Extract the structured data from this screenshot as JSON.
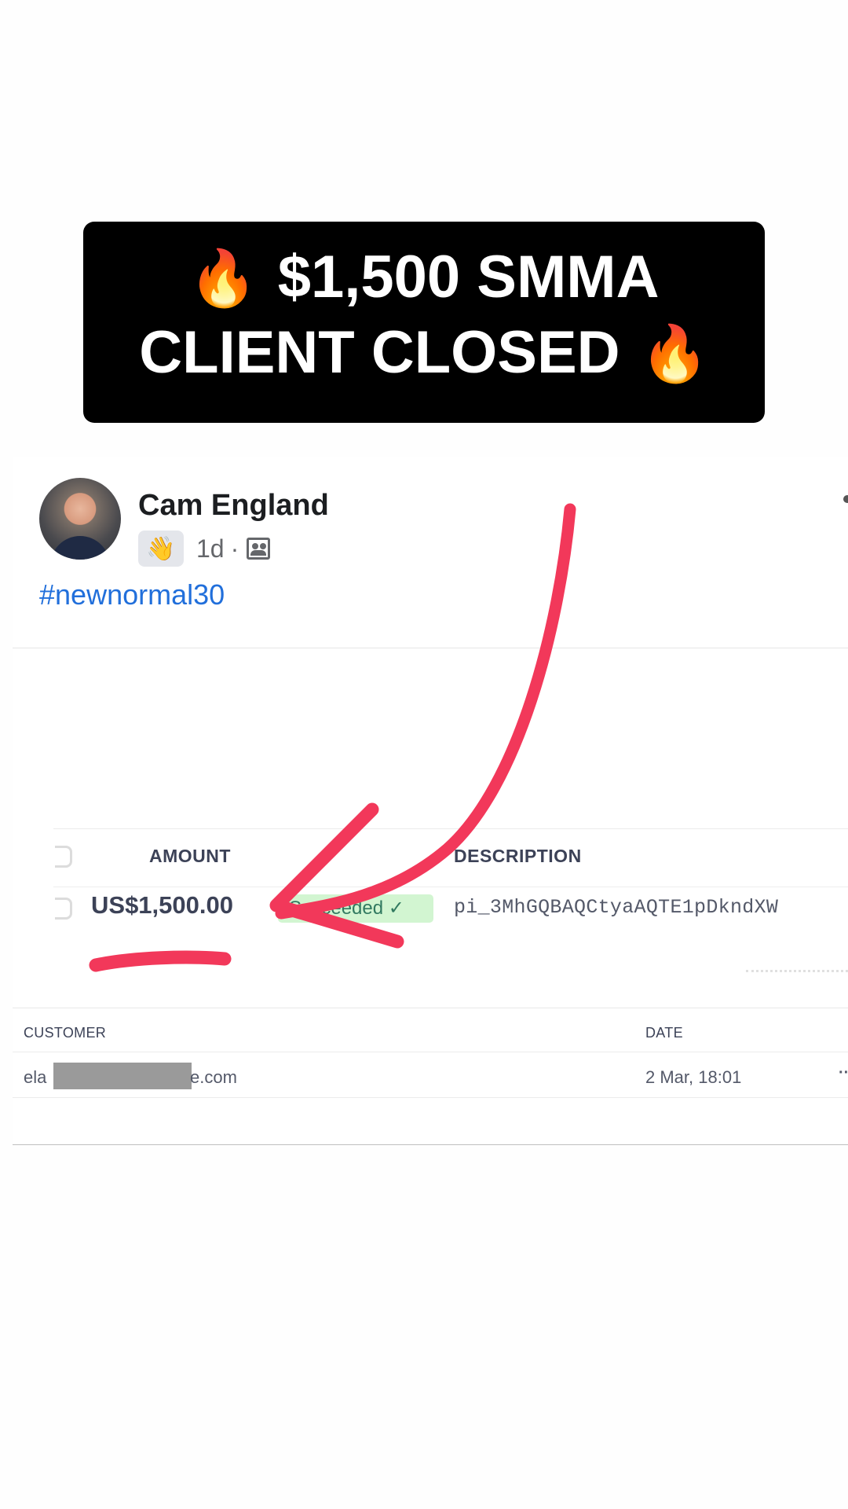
{
  "banner": {
    "line1": "$1,500 SMMA",
    "line2": "CLIENT CLOSED",
    "fire_emoji": "🔥"
  },
  "post": {
    "author_name": "Cam England",
    "wave_emoji": "👋",
    "time": "1d",
    "separator": "·",
    "audience_icon": "group-icon",
    "hashtag": "#newnormal30"
  },
  "payment": {
    "columns": {
      "amount": "AMOUNT",
      "description": "DESCRIPTION"
    },
    "amount": "US$1,500.00",
    "status": "Succeeded ✓",
    "description": "pi_3MhGQBAQCtyaAQTE1pDkndXW"
  },
  "customer_table": {
    "columns": {
      "customer": "CUSTOMER",
      "date": "DATE"
    },
    "customer_prefix": "ela",
    "customer_suffix": "e.com",
    "date": "2 Mar, 18:01",
    "more": "··"
  },
  "colors": {
    "banner_bg": "#000000",
    "banner_text": "#ffffff",
    "hashtag": "#216fdb",
    "annotation_red": "#f2385a",
    "status_bg": "#cbf4c9"
  }
}
